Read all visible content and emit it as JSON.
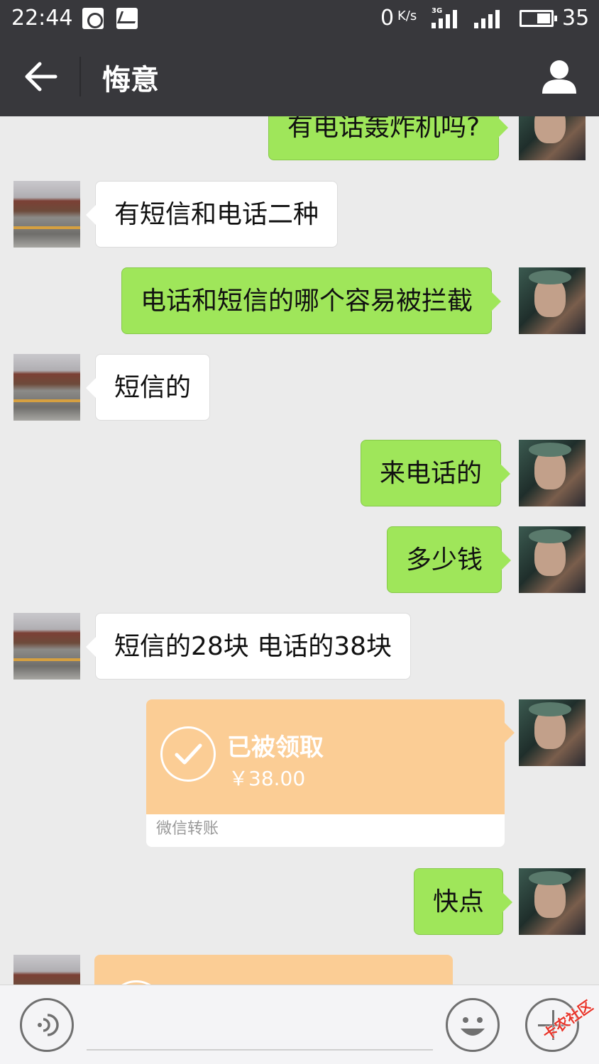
{
  "status_bar": {
    "time": "22:44",
    "net_speed": "0",
    "net_speed_unit": "K/s",
    "network_type": "3G",
    "battery": "35",
    "icons": [
      "uc-browser-icon",
      "mail-icon",
      "signal-icon",
      "battery-icon"
    ]
  },
  "header": {
    "back_icon": "arrow-left-icon",
    "title": "悔意",
    "profile_icon": "person-icon"
  },
  "messages": [
    {
      "sender": "me",
      "text": "有电话轰炸机吗?"
    },
    {
      "sender": "other",
      "text": "有短信和电话二种"
    },
    {
      "sender": "me",
      "text": "电话和短信的哪个容易被拦截"
    },
    {
      "sender": "other",
      "text": "短信的"
    },
    {
      "sender": "me",
      "text": "来电话的"
    },
    {
      "sender": "me",
      "text": "多少钱"
    },
    {
      "sender": "other",
      "text": "短信的28块  电话的38块"
    },
    {
      "sender": "me",
      "type": "transfer",
      "status": "已被领取",
      "amount": "￥38.00",
      "label": "微信转账"
    },
    {
      "sender": "me",
      "text": "快点"
    },
    {
      "sender": "other",
      "type": "transfer-partial"
    }
  ],
  "input_bar": {
    "voice_icon": "voice-icon",
    "emoji_icon": "smiley-icon",
    "more_icon": "plus-icon",
    "input_value": ""
  },
  "watermark": "卡农社区",
  "colors": {
    "bar_bg": "#38383c",
    "bubble_me": "#9fe65a",
    "bubble_other": "#ffffff",
    "transfer": "#fbcd95",
    "chat_bg": "#ebebeb"
  }
}
